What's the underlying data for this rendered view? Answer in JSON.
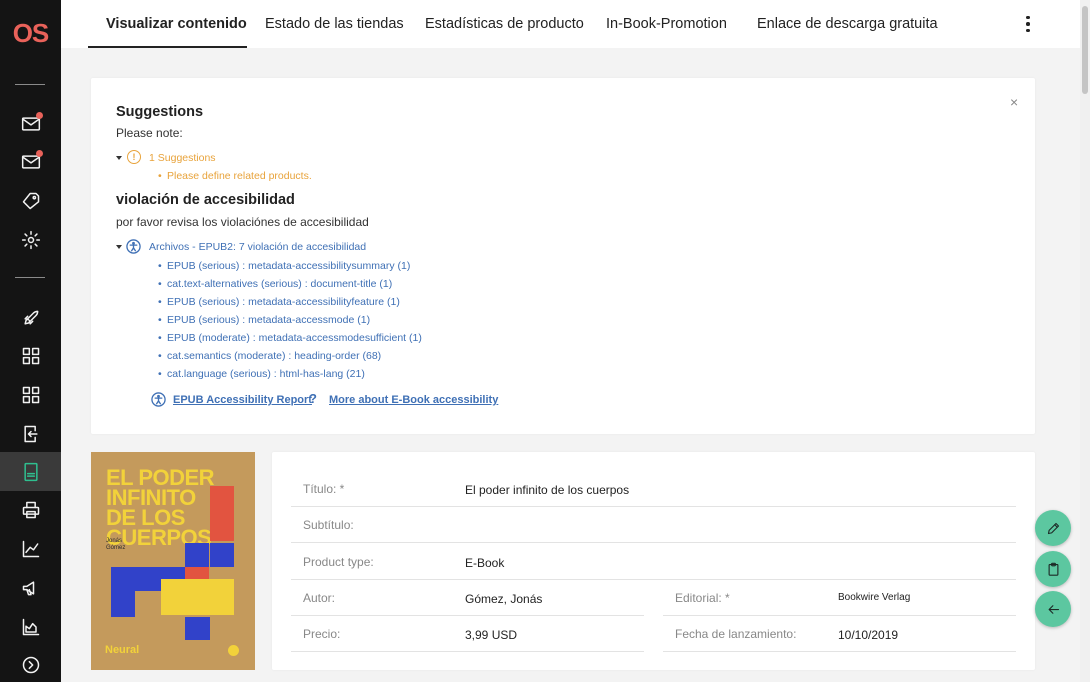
{
  "brand": {
    "logo_text": "OS",
    "accent": "#e9625a",
    "active": "#2fbf8f"
  },
  "tabs": [
    {
      "label": "Visualizar contenido",
      "active": true
    },
    {
      "label": "Estado de las tiendas"
    },
    {
      "label": "Estadísticas de producto"
    },
    {
      "label": "In-Book-Promotion"
    },
    {
      "label": "Enlace de descarga gratuita"
    }
  ],
  "sidebar": {
    "items": [
      {
        "icon": "mail-icon",
        "badge": true
      },
      {
        "icon": "mail-icon",
        "badge": true
      },
      {
        "icon": "tag-icon"
      },
      {
        "icon": "gear-icon"
      },
      {
        "icon": "rocket-icon"
      },
      {
        "icon": "grid-icon"
      },
      {
        "icon": "grid-icon"
      },
      {
        "icon": "import-icon"
      },
      {
        "icon": "document-icon",
        "active": true
      },
      {
        "icon": "printer-icon"
      },
      {
        "icon": "line-chart-icon"
      },
      {
        "icon": "megaphone-icon"
      },
      {
        "icon": "area-chart-icon"
      },
      {
        "icon": "arrow-right-circle-icon"
      }
    ]
  },
  "suggestions": {
    "title": "Suggestions",
    "note": "Please note:",
    "group_label": "1 Suggestions",
    "items": [
      "Please define related products."
    ]
  },
  "accessibility": {
    "title": "violación de accesibilidad",
    "note": "por favor revisa los violaciónes de accesibilidad",
    "group_label": "Archivos - EPUB2: 7 violación de accesibilidad",
    "items": [
      "EPUB (serious) : metadata-accessibilitysummary (1)",
      "cat.text-alternatives (serious) : document-title (1)",
      "EPUB (serious) : metadata-accessibilityfeature (1)",
      "EPUB (serious) : metadata-accessmode (1)",
      "EPUB (moderate) : metadata-accessmodesufficient (1)",
      "cat.semantics (moderate) : heading-order (68)",
      "cat.language (serious) : html-has-lang (21)"
    ],
    "report_link": "EPUB Accessibility Report",
    "more_link": "More about E-Book accessibility"
  },
  "cover": {
    "title": "EL PODER\nINFINITO\nDE LOS\nCUERPOS",
    "author": "Jonás\nGómez",
    "publisher_brand": "Neural"
  },
  "details": {
    "titulo": {
      "label": "Título: *",
      "value": "El poder infinito de los cuerpos"
    },
    "subtitulo": {
      "label": "Subtítulo:",
      "value": ""
    },
    "product_type": {
      "label": "Product type:",
      "value": "E-Book"
    },
    "autor": {
      "label": "Autor:",
      "value": "Gómez, Jonás"
    },
    "editorial": {
      "label": "Editorial: *",
      "value": "Bookwire Verlag"
    },
    "precio": {
      "label": "Precio:",
      "value": "3,99 USD"
    },
    "fecha": {
      "label": "Fecha de lanzamiento:",
      "value": "10/10/2019"
    }
  },
  "fabs": [
    {
      "icon": "pencil-icon"
    },
    {
      "icon": "clipboard-icon"
    },
    {
      "icon": "arrow-left-icon"
    }
  ]
}
